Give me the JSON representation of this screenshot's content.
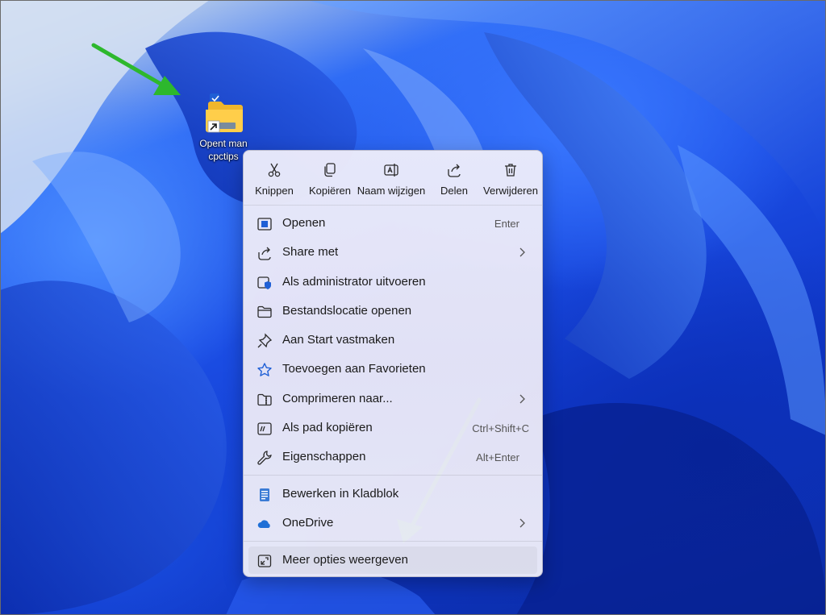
{
  "desktop": {
    "shortcut": {
      "label_line1": "Opent man",
      "label_line2": "cpctips"
    }
  },
  "context_menu": {
    "toolbar": [
      {
        "label": "Knippen",
        "icon": "scissors-icon"
      },
      {
        "label": "Kopiëren",
        "icon": "copy-icon"
      },
      {
        "label": "Naam wijzigen",
        "icon": "rename-icon"
      },
      {
        "label": "Delen",
        "icon": "share-icon"
      },
      {
        "label": "Verwijderen",
        "icon": "trash-icon"
      }
    ],
    "items": [
      {
        "label": "Openen",
        "shortcut": "Enter",
        "icon": "open-icon"
      },
      {
        "label": "Share met",
        "icon": "share-icon",
        "submenu": true
      },
      {
        "label": "Als administrator uitvoeren",
        "icon": "admin-shield-icon"
      },
      {
        "label": "Bestandslocatie openen",
        "icon": "folder-icon"
      },
      {
        "label": "Aan Start vastmaken",
        "icon": "pin-icon"
      },
      {
        "label": "Toevoegen aan Favorieten",
        "icon": "star-icon"
      },
      {
        "label": "Comprimeren naar...",
        "icon": "zip-folder-icon",
        "submenu": true
      },
      {
        "label": "Als pad kopiëren",
        "shortcut": "Ctrl+Shift+C",
        "icon": "copy-path-icon"
      },
      {
        "label": "Eigenschappen",
        "shortcut": "Alt+Enter",
        "icon": "wrench-icon"
      },
      {
        "label": "Bewerken in Kladblok",
        "icon": "notepad-icon"
      },
      {
        "label": "OneDrive",
        "icon": "onedrive-cloud-icon",
        "submenu": true
      },
      {
        "label": "Meer opties weergeven",
        "icon": "more-options-icon"
      }
    ]
  },
  "colors": {
    "annotation_arrow": "#2db82d",
    "accent": "#1f5fd6"
  }
}
